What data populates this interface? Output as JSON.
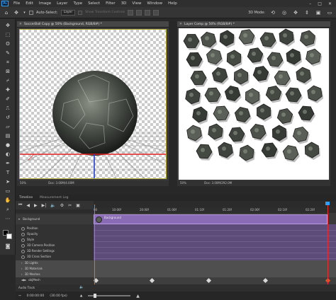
{
  "menu": {
    "items": [
      "File",
      "Edit",
      "Image",
      "Layer",
      "Type",
      "Select",
      "Filter",
      "3D",
      "View",
      "Window",
      "Help"
    ],
    "window_controls": [
      "–",
      "□",
      "✕"
    ]
  },
  "options": {
    "auto_select_label": "Auto-Select:",
    "auto_select_value": "Layer",
    "transform_label": "Show Transform Controls",
    "mode_label": "3D Mode:"
  },
  "doc_left": {
    "title": "SoccerBall Copy @ 50% (Background, RGB/8#) *",
    "zoom": "50%",
    "doc_info": "Doc: 3.00M/4.00M"
  },
  "doc_right": {
    "title": "Layer Comp @ 50% (RGB/8#) *",
    "zoom": "50%",
    "doc_info": "Doc: 3.00M/292.0M"
  },
  "timeline": {
    "tabs": [
      "Timeline",
      "Measurement Log"
    ],
    "ruler_ticks": [
      "00",
      "10:00f",
      "20:00f",
      "01:00f",
      "01:10f",
      "01:20f",
      "02:00f",
      "02:10f",
      "02:20f"
    ],
    "layer_name": "Background",
    "clip_label": "Background",
    "properties": [
      "Position",
      "Opacity",
      "Style",
      "3D Camera Position",
      "3D Render Settings",
      "3D Cross Section"
    ],
    "groups": [
      "3D Lights",
      "3D Materials",
      "3D Meshes"
    ],
    "mesh_item": "objMesh",
    "audio_label": "Audio Track",
    "timecode": "0:00:00:00",
    "fps": "(30.00 fps)"
  }
}
